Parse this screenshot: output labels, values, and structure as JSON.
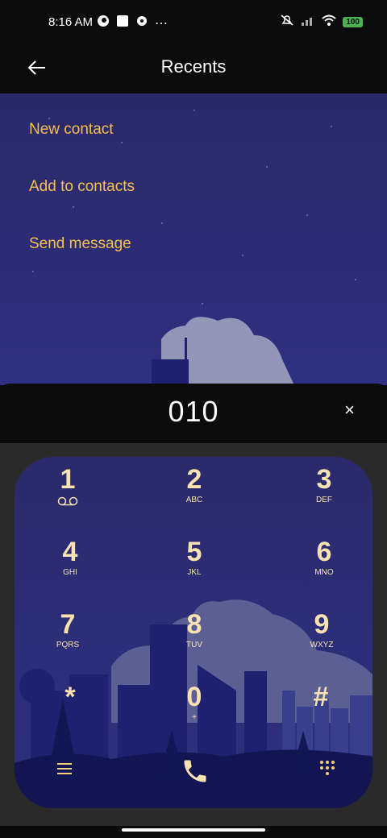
{
  "status_bar": {
    "time": "8:16 AM",
    "battery": "100"
  },
  "appbar": {
    "title": "Recents"
  },
  "menu": [
    {
      "label": "New contact"
    },
    {
      "label": "Add to contacts"
    },
    {
      "label": "Send message"
    }
  ],
  "dialer": {
    "number": "010",
    "clear": "×"
  },
  "keys": [
    {
      "digit": "1",
      "letters": ""
    },
    {
      "digit": "2",
      "letters": "ABC"
    },
    {
      "digit": "3",
      "letters": "DEF"
    },
    {
      "digit": "4",
      "letters": "GHI"
    },
    {
      "digit": "5",
      "letters": "JKL"
    },
    {
      "digit": "6",
      "letters": "MNO"
    },
    {
      "digit": "7",
      "letters": "PQRS"
    },
    {
      "digit": "8",
      "letters": "TUV"
    },
    {
      "digit": "9",
      "letters": "WXYZ"
    },
    {
      "digit": "*",
      "letters": ""
    },
    {
      "digit": "0",
      "letters": "+"
    },
    {
      "digit": "#",
      "letters": ""
    }
  ],
  "colors": {
    "accent": "#f4c04a",
    "key_text": "#f9e2b2"
  }
}
